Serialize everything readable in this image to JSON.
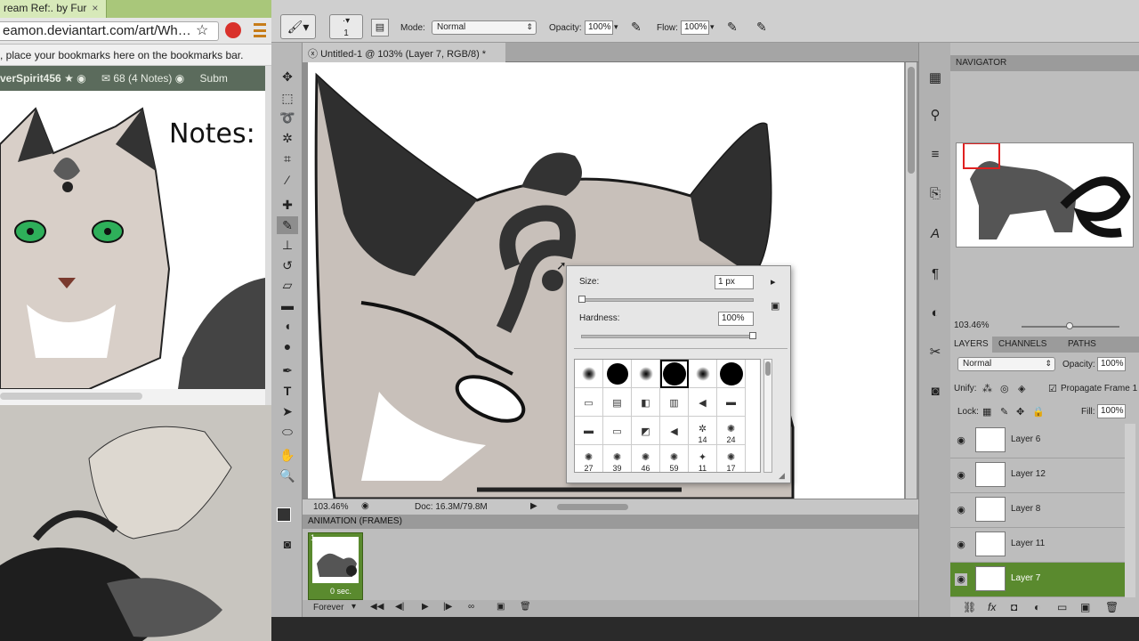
{
  "browser": {
    "tab_title": "ream Ref:. by Fur",
    "tab_close": "×",
    "url": "eamon.deviantart.com/art/Wh…",
    "bookmark_star": "☆",
    "bookmarks_hint": ", place your bookmarks here on the bookmarks bar.",
    "user": "verSpirit456",
    "notes": "68 (4 Notes)",
    "submit": "Subm",
    "notes_image_text": "Notes:"
  },
  "photoshop": {
    "brush_size_label": "1",
    "mode_label": "Mode:",
    "mode_value": "Normal",
    "opacity_label": "Opacity:",
    "opacity_value": "100%",
    "flow_label": "Flow:",
    "flow_value": "100%",
    "doc_tab": "Untitled-1 @ 103% (Layer 7, RGB/8) *",
    "zoom": "103.46%",
    "doc_size": "Doc: 16.3M/79.8M",
    "anim_header": "ANIMATION (FRAMES)",
    "frame_number": "1",
    "frame_delay": "0 sec.",
    "loop": "Forever"
  },
  "brush_popup": {
    "size_label": "Size:",
    "size_value": "1 px",
    "hardness_label": "Hardness:",
    "hardness_value": "100%",
    "brush_numbers": [
      "14",
      "24",
      "27",
      "39",
      "46",
      "59",
      "11",
      "17"
    ]
  },
  "navigator": {
    "title": "NAVIGATOR",
    "zoom": "103.46%"
  },
  "layers": {
    "tab_layers": "LAYERS",
    "tab_channels": "CHANNELS",
    "tab_paths": "PATHS",
    "blend_mode": "Normal",
    "opacity_label": "Opacity:",
    "opacity_value": "100%",
    "unify_label": "Unify:",
    "propagate_label": "Propagate Frame 1",
    "lock_label": "Lock:",
    "fill_label": "Fill:",
    "fill_value": "100%",
    "items": [
      {
        "name": "Layer 6"
      },
      {
        "name": "Layer 12"
      },
      {
        "name": "Layer 8"
      },
      {
        "name": "Layer 11"
      },
      {
        "name": "Layer 7"
      }
    ]
  },
  "colors": {
    "selected_layer": "#5a8a2e",
    "panel": "#bdbdbd"
  }
}
